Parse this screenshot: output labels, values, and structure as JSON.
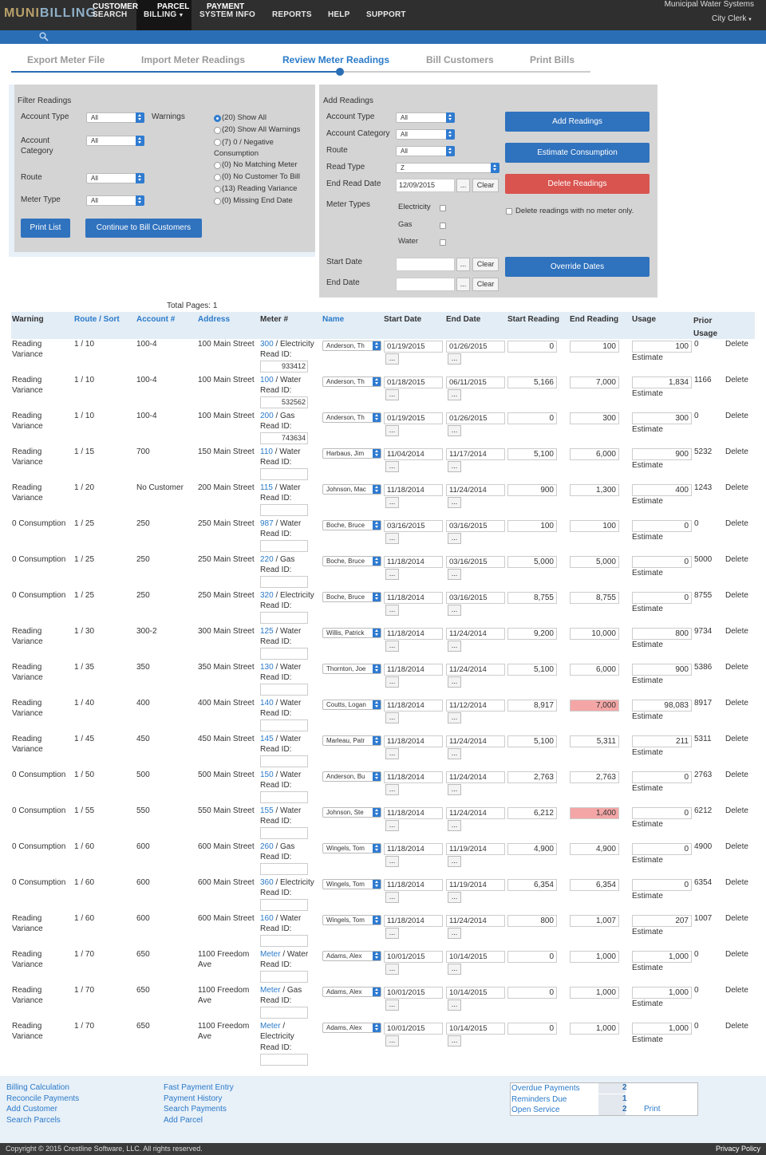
{
  "app": {
    "logo_a": "MUNI",
    "logo_b": "BILLING",
    "org": "Municipal Water Systems",
    "user": "City Clerk"
  },
  "nav": {
    "search": "SEARCH",
    "billing": "BILLING",
    "system_info": "SYSTEM INFO",
    "reports": "REPORTS",
    "help": "HELP",
    "support": "SUPPORT"
  },
  "subnav": {
    "customer": "CUSTOMER",
    "parcel": "PARCEL",
    "payment": "PAYMENT"
  },
  "steps": [
    "Export Meter File",
    "Import Meter Readings",
    "Review Meter Readings",
    "Bill Customers",
    "Print Bills"
  ],
  "filter": {
    "title": "Filter Readings",
    "account_type": "Account Type",
    "account_category": "Account Category",
    "route": "Route",
    "meter_type": "Meter Type",
    "warnings": "Warnings",
    "select_val": "All",
    "warning_opts": [
      "(20) Show All",
      "(20) Show All Warnings",
      "(7) 0 / Negative Consumption",
      "(0) No Matching Meter",
      "(0) No Customer To Bill",
      "(13) Reading Variance",
      "(0) Missing End Date"
    ],
    "print_list": "Print List",
    "continue": "Continue to Bill Customers"
  },
  "add": {
    "title": "Add Readings",
    "account_type": "Account Type",
    "account_category": "Account Category",
    "route": "Route",
    "read_type": "Read Type",
    "read_type_val": "Z",
    "end_read_date": "End Read Date",
    "end_read_val": "12/09/2015",
    "meter_types": "Meter Types",
    "electricity": "Electricity",
    "gas": "Gas",
    "water": "Water",
    "start_date": "Start Date",
    "end_date": "End Date",
    "clear": "Clear",
    "dots": "...",
    "select_val": "All",
    "add_btn": "Add Readings",
    "estimate_btn": "Estimate Consumption",
    "delete_btn": "Delete Readings",
    "delete_chk": "Delete readings with no meter only.",
    "override_btn": "Override Dates"
  },
  "table": {
    "total_pages": "Total Pages: 1",
    "headers": [
      "Warning",
      "Route / Sort",
      "Account #",
      "Address",
      "Meter #",
      "Name",
      "Start Date",
      "End Date",
      "Start Reading",
      "End Reading",
      "Usage",
      "Prior Usage"
    ],
    "read_id": "Read ID:",
    "estimate": "Estimate",
    "delete": "Delete",
    "dots": "...",
    "rows": [
      {
        "warn1": "Reading",
        "warn2": "Variance",
        "route": "1 / 10",
        "acct": "100-4",
        "addr1": "100 Main Street",
        "addr2": "",
        "meter_link": "300",
        "meter_type": " / Electricity",
        "meter_cont": "",
        "read_id": "933412",
        "name": "Anderson, Th",
        "sdate": "01/19/2015",
        "edate": "01/26/2015",
        "sread": "0",
        "eread": "100",
        "usage": "100",
        "prior": "0",
        "red": false
      },
      {
        "warn1": "Reading",
        "warn2": "Variance",
        "route": "1 / 10",
        "acct": "100-4",
        "addr1": "100 Main Street",
        "addr2": "",
        "meter_link": "100",
        "meter_type": " / Water",
        "meter_cont": "",
        "read_id": "532562",
        "name": "Anderson, Th",
        "sdate": "01/18/2015",
        "edate": "06/11/2015",
        "sread": "5,166",
        "eread": "7,000",
        "usage": "1,834",
        "prior": "1166",
        "red": false
      },
      {
        "warn1": "Reading",
        "warn2": "Variance",
        "route": "1 / 10",
        "acct": "100-4",
        "addr1": "100 Main Street",
        "addr2": "",
        "meter_link": "200",
        "meter_type": " / Gas",
        "meter_cont": "",
        "read_id": "743634",
        "name": "Anderson, Th",
        "sdate": "01/19/2015",
        "edate": "01/26/2015",
        "sread": "0",
        "eread": "300",
        "usage": "300",
        "prior": "0",
        "red": false
      },
      {
        "warn1": "Reading",
        "warn2": "Variance",
        "route": "1 / 15",
        "acct": "700",
        "addr1": "150 Main Street",
        "addr2": "",
        "meter_link": "110",
        "meter_type": " / Water",
        "meter_cont": "",
        "read_id": "",
        "name": "Harbaus, Jim",
        "sdate": "11/04/2014",
        "edate": "11/17/2014",
        "sread": "5,100",
        "eread": "6,000",
        "usage": "900",
        "prior": "5232",
        "red": false
      },
      {
        "warn1": "Reading",
        "warn2": "Variance",
        "route": "1 / 20",
        "acct": "No Customer",
        "addr1": "200 Main Street",
        "addr2": "",
        "meter_link": "115",
        "meter_type": " / Water",
        "meter_cont": "",
        "read_id": "",
        "name": "Johnson, Mac",
        "sdate": "11/18/2014",
        "edate": "11/24/2014",
        "sread": "900",
        "eread": "1,300",
        "usage": "400",
        "prior": "1243",
        "red": false
      },
      {
        "warn1": "0 Consumption",
        "warn2": "",
        "route": "1 / 25",
        "acct": "250",
        "addr1": "250 Main Street",
        "addr2": "",
        "meter_link": "987",
        "meter_type": " / Water",
        "meter_cont": "",
        "read_id": "",
        "name": "Boche, Bruce",
        "sdate": "03/16/2015",
        "edate": "03/16/2015",
        "sread": "100",
        "eread": "100",
        "usage": "0",
        "prior": "0",
        "red": false
      },
      {
        "warn1": "0 Consumption",
        "warn2": "",
        "route": "1 / 25",
        "acct": "250",
        "addr1": "250 Main Street",
        "addr2": "",
        "meter_link": "220",
        "meter_type": " / Gas",
        "meter_cont": "",
        "read_id": "",
        "name": "Boche, Bruce",
        "sdate": "11/18/2014",
        "edate": "03/16/2015",
        "sread": "5,000",
        "eread": "5,000",
        "usage": "0",
        "prior": "5000",
        "red": false
      },
      {
        "warn1": "0 Consumption",
        "warn2": "",
        "route": "1 / 25",
        "acct": "250",
        "addr1": "250 Main Street",
        "addr2": "",
        "meter_link": "320",
        "meter_type": " / Electricity",
        "meter_cont": "",
        "read_id": "",
        "name": "Boche, Bruce",
        "sdate": "11/18/2014",
        "edate": "03/16/2015",
        "sread": "8,755",
        "eread": "8,755",
        "usage": "0",
        "prior": "8755",
        "red": false
      },
      {
        "warn1": "Reading",
        "warn2": "Variance",
        "route": "1 / 30",
        "acct": "300-2",
        "addr1": "300 Main Street",
        "addr2": "",
        "meter_link": "125",
        "meter_type": " / Water",
        "meter_cont": "",
        "read_id": "",
        "name": "Willis, Patrick",
        "sdate": "11/18/2014",
        "edate": "11/24/2014",
        "sread": "9,200",
        "eread": "10,000",
        "usage": "800",
        "prior": "9734",
        "red": false
      },
      {
        "warn1": "Reading",
        "warn2": "Variance",
        "route": "1 / 35",
        "acct": "350",
        "addr1": "350 Main Street",
        "addr2": "",
        "meter_link": "130",
        "meter_type": " / Water",
        "meter_cont": "",
        "read_id": "",
        "name": "Thornton, Joe",
        "sdate": "11/18/2014",
        "edate": "11/24/2014",
        "sread": "5,100",
        "eread": "6,000",
        "usage": "900",
        "prior": "5386",
        "red": false
      },
      {
        "warn1": "Reading",
        "warn2": "Variance",
        "route": "1 / 40",
        "acct": "400",
        "addr1": "400 Main Street",
        "addr2": "",
        "meter_link": "140",
        "meter_type": " / Water",
        "meter_cont": "",
        "read_id": "",
        "name": "Coutts, Logan",
        "sdate": "11/18/2014",
        "edate": "11/12/2014",
        "sread": "8,917",
        "eread": "7,000",
        "usage": "98,083",
        "prior": "8917",
        "red": true
      },
      {
        "warn1": "Reading",
        "warn2": "Variance",
        "route": "1 / 45",
        "acct": "450",
        "addr1": "450 Main Street",
        "addr2": "",
        "meter_link": "145",
        "meter_type": " / Water",
        "meter_cont": "",
        "read_id": "",
        "name": "Marleau, Patr",
        "sdate": "11/18/2014",
        "edate": "11/24/2014",
        "sread": "5,100",
        "eread": "5,311",
        "usage": "211",
        "prior": "5311",
        "red": false
      },
      {
        "warn1": "0 Consumption",
        "warn2": "",
        "route": "1 / 50",
        "acct": "500",
        "addr1": "500 Main Street",
        "addr2": "",
        "meter_link": "150",
        "meter_type": " / Water",
        "meter_cont": "",
        "read_id": "",
        "name": "Anderson, Bu",
        "sdate": "11/18/2014",
        "edate": "11/24/2014",
        "sread": "2,763",
        "eread": "2,763",
        "usage": "0",
        "prior": "2763",
        "red": false
      },
      {
        "warn1": "0 Consumption",
        "warn2": "",
        "route": "1 / 55",
        "acct": "550",
        "addr1": "550 Main Street",
        "addr2": "",
        "meter_link": "155",
        "meter_type": " / Water",
        "meter_cont": "",
        "read_id": "",
        "name": "Johnson, Ste",
        "sdate": "11/18/2014",
        "edate": "11/24/2014",
        "sread": "6,212",
        "eread": "1,400",
        "usage": "0",
        "prior": "6212",
        "red": true
      },
      {
        "warn1": "0 Consumption",
        "warn2": "",
        "route": "1 / 60",
        "acct": "600",
        "addr1": "600 Main Street",
        "addr2": "",
        "meter_link": "260",
        "meter_type": " / Gas",
        "meter_cont": "",
        "read_id": "",
        "name": "Wingels, Tom",
        "sdate": "11/18/2014",
        "edate": "11/19/2014",
        "sread": "4,900",
        "eread": "4,900",
        "usage": "0",
        "prior": "4900",
        "red": false
      },
      {
        "warn1": "0 Consumption",
        "warn2": "",
        "route": "1 / 60",
        "acct": "600",
        "addr1": "600 Main Street",
        "addr2": "",
        "meter_link": "360",
        "meter_type": " / Electricity",
        "meter_cont": "",
        "read_id": "",
        "name": "Wingels, Tom",
        "sdate": "11/18/2014",
        "edate": "11/19/2014",
        "sread": "6,354",
        "eread": "6,354",
        "usage": "0",
        "prior": "6354",
        "red": false
      },
      {
        "warn1": "Reading",
        "warn2": "Variance",
        "route": "1 / 60",
        "acct": "600",
        "addr1": "600 Main Street",
        "addr2": "",
        "meter_link": "160",
        "meter_type": " / Water",
        "meter_cont": "",
        "read_id": "",
        "name": "Wingels, Tom",
        "sdate": "11/18/2014",
        "edate": "11/24/2014",
        "sread": "800",
        "eread": "1,007",
        "usage": "207",
        "prior": "1007",
        "red": false
      },
      {
        "warn1": "Reading",
        "warn2": "Variance",
        "route": "1 / 70",
        "acct": "650",
        "addr1": "1100 Freedom",
        "addr2": "Ave",
        "meter_link": "Meter",
        "meter_type": " / Water",
        "meter_cont": "",
        "read_id": "",
        "name": "Adams, Alex",
        "sdate": "10/01/2015",
        "edate": "10/14/2015",
        "sread": "0",
        "eread": "1,000",
        "usage": "1,000",
        "prior": "0",
        "red": false
      },
      {
        "warn1": "Reading",
        "warn2": "Variance",
        "route": "1 / 70",
        "acct": "650",
        "addr1": "1100 Freedom",
        "addr2": "Ave",
        "meter_link": "Meter",
        "meter_type": " / Gas",
        "meter_cont": "",
        "read_id": "",
        "name": "Adams, Alex",
        "sdate": "10/01/2015",
        "edate": "10/14/2015",
        "sread": "0",
        "eread": "1,000",
        "usage": "1,000",
        "prior": "0",
        "red": false
      },
      {
        "warn1": "Reading",
        "warn2": "Variance",
        "route": "1 / 70",
        "acct": "650",
        "addr1": "1100 Freedom",
        "addr2": "Ave",
        "meter_link": "Meter",
        "meter_type": " /",
        "meter_cont": "Electricity",
        "read_id": "",
        "name": "Adams, Alex",
        "sdate": "10/01/2015",
        "edate": "10/14/2015",
        "sread": "0",
        "eread": "1,000",
        "usage": "1,000",
        "prior": "0",
        "red": false
      }
    ]
  },
  "footer": {
    "col1": [
      "Billing Calculation",
      "Reconcile Payments",
      "Add Customer",
      "Search Parcels"
    ],
    "col2": [
      "Fast Payment Entry",
      "Payment History",
      "Search Payments",
      "Add Parcel"
    ],
    "stats": [
      {
        "label": "Overdue Payments",
        "val": "2"
      },
      {
        "label": "Reminders Due",
        "val": "1"
      },
      {
        "label": "Open Service",
        "val": "2"
      }
    ],
    "print": "Print",
    "copyright": "Copyright © 2015 Crestline Software, LLC. All rights reserved.",
    "privacy": "Privacy Policy"
  }
}
